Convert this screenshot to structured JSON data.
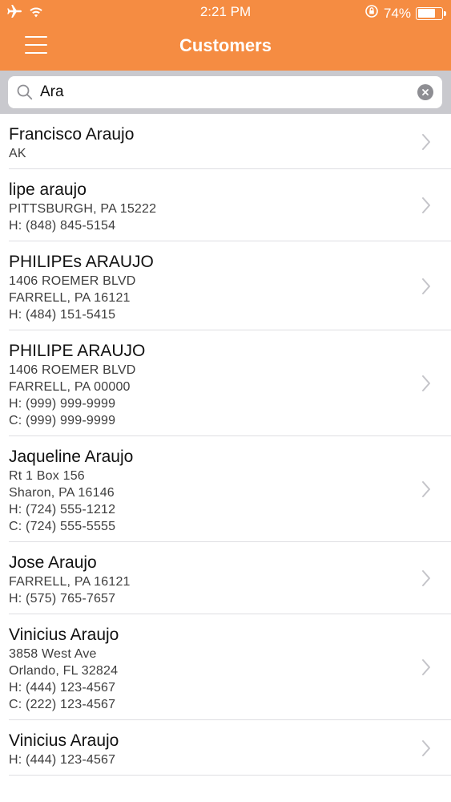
{
  "status_bar": {
    "time": "2:21 PM",
    "battery_percent": "74%",
    "battery_level": 0.74
  },
  "nav": {
    "title": "Customers",
    "menu_icon": "hamburger-menu-icon"
  },
  "search": {
    "value": "Ara",
    "icon": "search-icon",
    "clear_icon": "clear-icon"
  },
  "colors": {
    "accent": "#f58c42",
    "search_bg": "#c9c9ce"
  },
  "customers": [
    {
      "name": "Francisco Araujo",
      "lines": [
        "AK"
      ]
    },
    {
      "name": "lipe araujo",
      "lines": [
        "PITTSBURGH, PA 15222",
        "H: (848) 845-5154"
      ]
    },
    {
      "name": "PHILIPEs ARAUJO",
      "lines": [
        "1406 ROEMER BLVD",
        "FARRELL, PA 16121",
        "H: (484) 151-5415"
      ]
    },
    {
      "name": "PHILIPE ARAUJO",
      "lines": [
        "1406 ROEMER BLVD",
        "FARRELL, PA 00000",
        "H: (999) 999-9999",
        "C: (999) 999-9999"
      ]
    },
    {
      "name": "Jaqueline Araujo",
      "lines": [
        "Rt 1 Box 156",
        "Sharon, PA 16146",
        "H: (724) 555-1212",
        "C: (724) 555-5555"
      ]
    },
    {
      "name": "Jose Araujo",
      "lines": [
        "FARRELL, PA 16121",
        "H: (575) 765-7657"
      ]
    },
    {
      "name": "Vinicius Araujo",
      "lines": [
        "3858 West Ave",
        "Orlando, FL 32824",
        "H: (444) 123-4567",
        "C: (222) 123-4567"
      ]
    },
    {
      "name": "Vinicius Araujo",
      "lines": [
        "H: (444) 123-4567"
      ]
    }
  ]
}
